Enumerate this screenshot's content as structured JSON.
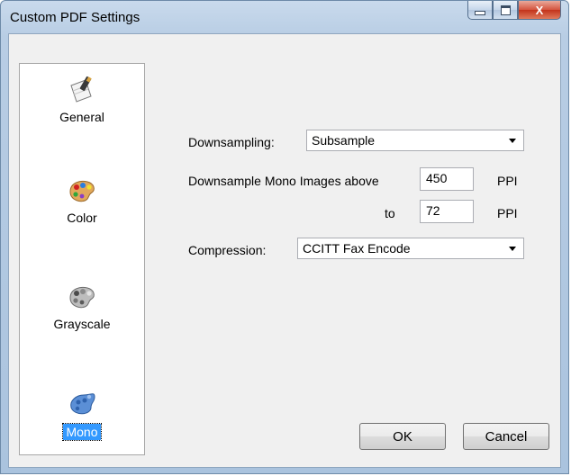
{
  "window": {
    "title": "Custom PDF Settings",
    "close_glyph": "X"
  },
  "sidebar": {
    "items": [
      {
        "label": "General",
        "icon": "document-pen-icon"
      },
      {
        "label": "Color",
        "icon": "color-palette-icon"
      },
      {
        "label": "Grayscale",
        "icon": "grayscale-palette-icon"
      },
      {
        "label": "Mono",
        "icon": "mono-palette-icon",
        "selected": true
      }
    ]
  },
  "form": {
    "downsampling_label": "Downsampling:",
    "downsampling_value": "Subsample",
    "downsample_above_label": "Downsample Mono Images above",
    "above_value": "450",
    "above_unit": "PPI",
    "to_label": "to",
    "to_value": "72",
    "to_unit": "PPI",
    "compression_label": "Compression:",
    "compression_value": "CCITT Fax Encode"
  },
  "buttons": {
    "ok": "OK",
    "cancel": "Cancel"
  },
  "colors": {
    "selection": "#3399ff",
    "frame": "#b8cde4"
  }
}
